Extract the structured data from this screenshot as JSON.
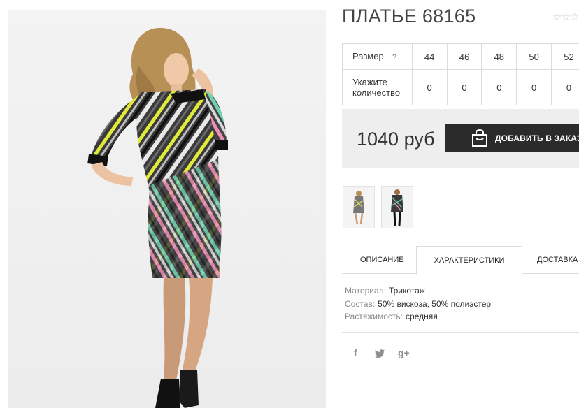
{
  "product": {
    "title": "ПЛАТЬЕ 68165",
    "rating_stars": "☆☆☆",
    "main_image_alt": "dress-photo"
  },
  "sizes": {
    "label": "Размер",
    "help": "?",
    "values": [
      "44",
      "46",
      "48",
      "50",
      "52"
    ],
    "quantity_label_line1": "Укажите",
    "quantity_label_line2": "количество",
    "quantities": [
      "0",
      "0",
      "0",
      "0",
      "0"
    ]
  },
  "price": {
    "value": "1040 руб",
    "add_button": "ДОБАВИТЬ В ЗАКАЗ"
  },
  "tabs": {
    "description": "ОПИСАНИЕ",
    "characteristics": "ХАРАКТЕРИСТИКИ",
    "delivery": "ДОСТАВКА И"
  },
  "specs": [
    {
      "key": "Материал:",
      "value": "Трикотаж"
    },
    {
      "key": "Состав:",
      "value": "50% вискоза, 50% полиэстер"
    },
    {
      "key": "Растяжимость:",
      "value": "средняя"
    }
  ],
  "social": {
    "facebook": "f",
    "twitter": "twitter",
    "googleplus": "g+"
  },
  "colors": {
    "button_bg": "#2b2b2b",
    "price_box_bg": "#eeeeee",
    "border": "#dcdcdc"
  }
}
